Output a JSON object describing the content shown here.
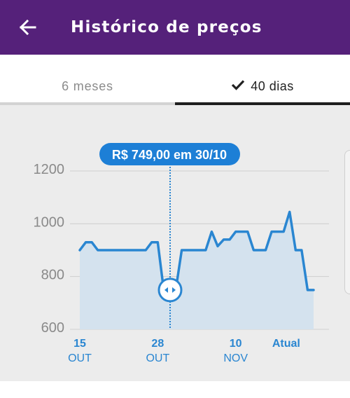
{
  "header": {
    "title": "Histórico de preços",
    "back_icon": "arrow-left-icon"
  },
  "tabs": [
    {
      "label": "6 meses",
      "selected": false
    },
    {
      "label": "40 dias",
      "selected": true,
      "icon": "check-icon"
    }
  ],
  "tooltip": {
    "text": "R$ 749,00 em 30/10",
    "handle_icon": "drag-arrows-icon"
  },
  "colors": {
    "header_bg": "#55217a",
    "accent_blue": "#2a86d1",
    "tooltip_bg": "#1d7fd6",
    "area_fill": "#d4e2ee",
    "chart_bg": "#ececec"
  },
  "chart_data": {
    "type": "area",
    "title": "",
    "xlabel": "",
    "ylabel": "",
    "ylim": [
      600,
      1200
    ],
    "y_ticks": [
      "1200",
      "1000",
      "800",
      "600"
    ],
    "x_ticks": [
      {
        "top": "15",
        "bottom": "OUT",
        "day": 0
      },
      {
        "top": "28",
        "bottom": "OUT",
        "day": 13
      },
      {
        "top": "10",
        "bottom": "NOV",
        "day": 26
      },
      {
        "top": "Atual",
        "bottom": "",
        "day": 37
      }
    ],
    "grid": true,
    "selected_point": {
      "day": 15,
      "value": 749
    },
    "series": [
      {
        "values": [
          [
            0,
            900
          ],
          [
            1,
            930
          ],
          [
            2,
            930
          ],
          [
            3,
            900
          ],
          [
            4,
            900
          ],
          [
            5,
            900
          ],
          [
            6,
            900
          ],
          [
            7,
            900
          ],
          [
            8,
            900
          ],
          [
            9,
            900
          ],
          [
            10,
            900
          ],
          [
            11,
            900
          ],
          [
            12,
            930
          ],
          [
            13,
            930
          ],
          [
            14,
            749
          ],
          [
            15,
            749
          ],
          [
            16,
            749
          ],
          [
            17,
            900
          ],
          [
            18,
            900
          ],
          [
            19,
            900
          ],
          [
            20,
            900
          ],
          [
            21,
            900
          ],
          [
            22,
            970
          ],
          [
            23,
            915
          ],
          [
            24,
            940
          ],
          [
            25,
            940
          ],
          [
            26,
            970
          ],
          [
            27,
            970
          ],
          [
            28,
            970
          ],
          [
            29,
            900
          ],
          [
            30,
            900
          ],
          [
            31,
            900
          ],
          [
            32,
            970
          ],
          [
            33,
            970
          ],
          [
            34,
            970
          ],
          [
            35,
            1045
          ],
          [
            36,
            900
          ],
          [
            37,
            900
          ],
          [
            38,
            749
          ],
          [
            39,
            749
          ]
        ]
      }
    ]
  }
}
